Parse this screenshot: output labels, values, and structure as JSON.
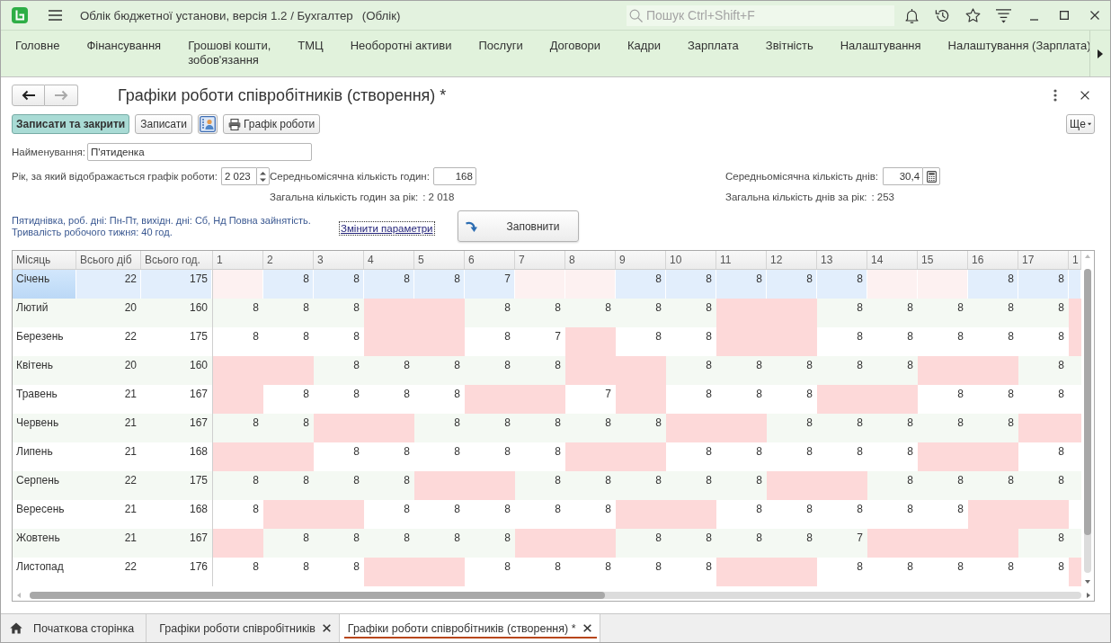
{
  "app": {
    "title": "Облік бюджетної установи, версія 1.2 / Бухгалтер",
    "mode": "(Облік)",
    "search": {
      "placeholder": "Пошук Ctrl+Shift+F"
    }
  },
  "menu": [
    "Головне",
    "Фінансування",
    "Грошові кошти,\nзобов'язання",
    "ТМЦ",
    "Необоротні активи",
    "Послуги",
    "Договори",
    "Кадри",
    "Зарплата",
    "Звітність",
    "Налаштування",
    "Налаштування (Зарплата)"
  ],
  "form": {
    "navigation": [
      {
        "kind": "back",
        "disabled": false
      },
      {
        "kind": "forward",
        "disabled": true
      }
    ],
    "title": "Графіки роботи співробітників (створення) *",
    "toolbar": [
      {
        "kind": "default",
        "label": "Записати та закрити"
      },
      {
        "kind": "plain",
        "label": "Записати"
      },
      {
        "kind": "contacts"
      },
      {
        "kind": "print",
        "label": "Графік роботи"
      }
    ],
    "more": "Ще",
    "name": {
      "label": "Найменування:",
      "value": "П'ятиденка"
    },
    "year": {
      "label": "Рік, за який відображається графік роботи:",
      "value": "2 023"
    },
    "avg_hours": {
      "label": "Середньомісячна кількість годин:",
      "value": "168"
    },
    "avg_days": {
      "label": "Середньомісячна кількість днів:",
      "value": "30,4"
    },
    "total_hours": {
      "label": "Загальна кількість годин за рік:",
      "value": ": 2 018"
    },
    "total_days": {
      "label": "Загальна кількість днів за рік:",
      "value": ": 253"
    },
    "description": [
      "Пятиднівка, роб. дні: Пн-Пт, вихідн. дні: Сб, Нд Повна зайнятість.",
      "Тривалість робочого тижня: 40 год."
    ],
    "change_link": {
      "label": "Змінити параметри",
      "focused": true
    },
    "fill_button": "Заповнити"
  },
  "table": {
    "columns": [
      "Місяць",
      "Всього діб",
      "Всього год.",
      "1",
      "2",
      "3",
      "4",
      "5",
      "6",
      "7",
      "8",
      "9",
      "10",
      "11",
      "12",
      "13",
      "14",
      "15",
      "16",
      "17",
      "1"
    ],
    "rows": [
      {
        "month": "Січень",
        "days": "22",
        "hours": "175",
        "selected": true,
        "cells": [
          {
            "holiday": true
          },
          {
            "value": "8",
            "holiday": false
          },
          {
            "value": "8",
            "holiday": false
          },
          {
            "value": "8",
            "holiday": false
          },
          {
            "value": "8",
            "holiday": false
          },
          {
            "value": "7",
            "holiday": false
          },
          {
            "holiday": true
          },
          {
            "holiday": true
          },
          {
            "value": "8",
            "holiday": false
          },
          {
            "value": "8",
            "holiday": false
          },
          {
            "value": "8",
            "holiday": false
          },
          {
            "value": "8",
            "holiday": false
          },
          {
            "value": "8",
            "holiday": false
          },
          {
            "holiday": true
          },
          {
            "holiday": true
          },
          {
            "value": "8",
            "holiday": false
          },
          {
            "value": "8",
            "holiday": false
          },
          {
            "holiday": false
          }
        ]
      },
      {
        "month": "Лютий",
        "days": "20",
        "hours": "160",
        "selected": false,
        "cells": [
          {
            "value": "8",
            "holiday": false
          },
          {
            "value": "8",
            "holiday": false
          },
          {
            "value": "8",
            "holiday": false
          },
          {
            "holiday": true
          },
          {
            "holiday": true
          },
          {
            "value": "8",
            "holiday": false
          },
          {
            "value": "8",
            "holiday": false
          },
          {
            "value": "8",
            "holiday": false
          },
          {
            "value": "8",
            "holiday": false
          },
          {
            "value": "8",
            "holiday": false
          },
          {
            "holiday": true
          },
          {
            "holiday": true
          },
          {
            "value": "8",
            "holiday": false
          },
          {
            "value": "8",
            "holiday": false
          },
          {
            "value": "8",
            "holiday": false
          },
          {
            "value": "8",
            "holiday": false
          },
          {
            "value": "8",
            "holiday": false
          },
          {
            "holiday": true
          }
        ]
      },
      {
        "month": "Березень",
        "days": "22",
        "hours": "175",
        "selected": false,
        "cells": [
          {
            "value": "8",
            "holiday": false
          },
          {
            "value": "8",
            "holiday": false
          },
          {
            "value": "8",
            "holiday": false
          },
          {
            "holiday": true
          },
          {
            "holiday": true
          },
          {
            "value": "8",
            "holiday": false
          },
          {
            "value": "7",
            "holiday": false
          },
          {
            "holiday": true
          },
          {
            "value": "8",
            "holiday": false
          },
          {
            "value": "8",
            "holiday": false
          },
          {
            "holiday": true
          },
          {
            "holiday": true
          },
          {
            "value": "8",
            "holiday": false
          },
          {
            "value": "8",
            "holiday": false
          },
          {
            "value": "8",
            "holiday": false
          },
          {
            "value": "8",
            "holiday": false
          },
          {
            "value": "8",
            "holiday": false
          },
          {
            "holiday": true
          }
        ]
      },
      {
        "month": "Квітень",
        "days": "20",
        "hours": "160",
        "selected": false,
        "cells": [
          {
            "holiday": true
          },
          {
            "holiday": true
          },
          {
            "value": "8",
            "holiday": false
          },
          {
            "value": "8",
            "holiday": false
          },
          {
            "value": "8",
            "holiday": false
          },
          {
            "value": "8",
            "holiday": false
          },
          {
            "value": "8",
            "holiday": false
          },
          {
            "holiday": true
          },
          {
            "holiday": true
          },
          {
            "value": "8",
            "holiday": false
          },
          {
            "value": "8",
            "holiday": false
          },
          {
            "value": "8",
            "holiday": false
          },
          {
            "value": "8",
            "holiday": false
          },
          {
            "value": "8",
            "holiday": false
          },
          {
            "holiday": true
          },
          {
            "holiday": true
          },
          {
            "value": "8",
            "holiday": false
          },
          {
            "holiday": false
          }
        ]
      },
      {
        "month": "Травень",
        "days": "21",
        "hours": "167",
        "selected": false,
        "cells": [
          {
            "holiday": true
          },
          {
            "value": "8",
            "holiday": false
          },
          {
            "value": "8",
            "holiday": false
          },
          {
            "value": "8",
            "holiday": false
          },
          {
            "value": "8",
            "holiday": false
          },
          {
            "holiday": true
          },
          {
            "holiday": true
          },
          {
            "value": "7",
            "holiday": false
          },
          {
            "holiday": true
          },
          {
            "value": "8",
            "holiday": false
          },
          {
            "value": "8",
            "holiday": false
          },
          {
            "value": "8",
            "holiday": false
          },
          {
            "holiday": true
          },
          {
            "holiday": true
          },
          {
            "value": "8",
            "holiday": false
          },
          {
            "value": "8",
            "holiday": false
          },
          {
            "value": "8",
            "holiday": false
          },
          {
            "holiday": false
          }
        ]
      },
      {
        "month": "Червень",
        "days": "21",
        "hours": "167",
        "selected": false,
        "cells": [
          {
            "value": "8",
            "holiday": false
          },
          {
            "value": "8",
            "holiday": false
          },
          {
            "holiday": true
          },
          {
            "holiday": true
          },
          {
            "value": "8",
            "holiday": false
          },
          {
            "value": "8",
            "holiday": false
          },
          {
            "value": "8",
            "holiday": false
          },
          {
            "value": "8",
            "holiday": false
          },
          {
            "value": "8",
            "holiday": false
          },
          {
            "holiday": true
          },
          {
            "holiday": true
          },
          {
            "value": "8",
            "holiday": false
          },
          {
            "value": "8",
            "holiday": false
          },
          {
            "value": "8",
            "holiday": false
          },
          {
            "value": "8",
            "holiday": false
          },
          {
            "value": "8",
            "holiday": false
          },
          {
            "holiday": true
          },
          {
            "holiday": true
          }
        ]
      },
      {
        "month": "Липень",
        "days": "21",
        "hours": "168",
        "selected": false,
        "cells": [
          {
            "holiday": true
          },
          {
            "holiday": true
          },
          {
            "value": "8",
            "holiday": false
          },
          {
            "value": "8",
            "holiday": false
          },
          {
            "value": "8",
            "holiday": false
          },
          {
            "value": "8",
            "holiday": false
          },
          {
            "value": "8",
            "holiday": false
          },
          {
            "holiday": true
          },
          {
            "holiday": true
          },
          {
            "value": "8",
            "holiday": false
          },
          {
            "value": "8",
            "holiday": false
          },
          {
            "value": "8",
            "holiday": false
          },
          {
            "value": "8",
            "holiday": false
          },
          {
            "value": "8",
            "holiday": false
          },
          {
            "holiday": true
          },
          {
            "holiday": true
          },
          {
            "value": "8",
            "holiday": false
          },
          {
            "holiday": false
          }
        ]
      },
      {
        "month": "Серпень",
        "days": "22",
        "hours": "175",
        "selected": false,
        "cells": [
          {
            "value": "8",
            "holiday": false
          },
          {
            "value": "8",
            "holiday": false
          },
          {
            "value": "8",
            "holiday": false
          },
          {
            "value": "8",
            "holiday": false
          },
          {
            "holiday": true
          },
          {
            "holiday": true
          },
          {
            "value": "8",
            "holiday": false
          },
          {
            "value": "8",
            "holiday": false
          },
          {
            "value": "8",
            "holiday": false
          },
          {
            "value": "8",
            "holiday": false
          },
          {
            "value": "8",
            "holiday": false
          },
          {
            "holiday": true
          },
          {
            "holiday": true
          },
          {
            "value": "8",
            "holiday": false
          },
          {
            "value": "8",
            "holiday": false
          },
          {
            "value": "8",
            "holiday": false
          },
          {
            "value": "8",
            "holiday": false
          },
          {
            "holiday": false
          }
        ]
      },
      {
        "month": "Вересень",
        "days": "21",
        "hours": "168",
        "selected": false,
        "cells": [
          {
            "value": "8",
            "holiday": false
          },
          {
            "holiday": true
          },
          {
            "holiday": true
          },
          {
            "value": "8",
            "holiday": false
          },
          {
            "value": "8",
            "holiday": false
          },
          {
            "value": "8",
            "holiday": false
          },
          {
            "value": "8",
            "holiday": false
          },
          {
            "value": "8",
            "holiday": false
          },
          {
            "holiday": true
          },
          {
            "holiday": true
          },
          {
            "value": "8",
            "holiday": false
          },
          {
            "value": "8",
            "holiday": false
          },
          {
            "value": "8",
            "holiday": false
          },
          {
            "value": "8",
            "holiday": false
          },
          {
            "value": "8",
            "holiday": false
          },
          {
            "holiday": true
          },
          {
            "holiday": true
          },
          {
            "holiday": false
          }
        ]
      },
      {
        "month": "Жовтень",
        "days": "21",
        "hours": "167",
        "selected": false,
        "cells": [
          {
            "holiday": true
          },
          {
            "value": "8",
            "holiday": false
          },
          {
            "value": "8",
            "holiday": false
          },
          {
            "value": "8",
            "holiday": false
          },
          {
            "value": "8",
            "holiday": false
          },
          {
            "value": "8",
            "holiday": false
          },
          {
            "holiday": true
          },
          {
            "holiday": true
          },
          {
            "value": "8",
            "holiday": false
          },
          {
            "value": "8",
            "holiday": false
          },
          {
            "value": "8",
            "holiday": false
          },
          {
            "value": "8",
            "holiday": false
          },
          {
            "value": "7",
            "holiday": false
          },
          {
            "holiday": true
          },
          {
            "holiday": true
          },
          {
            "holiday": true
          },
          {
            "value": "8",
            "holiday": false
          },
          {
            "holiday": false
          }
        ]
      },
      {
        "month": "Листопад",
        "days": "22",
        "hours": "176",
        "selected": false,
        "cells": [
          {
            "value": "8",
            "holiday": false
          },
          {
            "value": "8",
            "holiday": false
          },
          {
            "value": "8",
            "holiday": false
          },
          {
            "holiday": true
          },
          {
            "holiday": true
          },
          {
            "value": "8",
            "holiday": false
          },
          {
            "value": "8",
            "holiday": false
          },
          {
            "value": "8",
            "holiday": false
          },
          {
            "value": "8",
            "holiday": false
          },
          {
            "value": "8",
            "holiday": false
          },
          {
            "holiday": true
          },
          {
            "holiday": true
          },
          {
            "value": "8",
            "holiday": false
          },
          {
            "value": "8",
            "holiday": false
          },
          {
            "value": "8",
            "holiday": false
          },
          {
            "value": "8",
            "holiday": false
          },
          {
            "value": "8",
            "holiday": false
          },
          {
            "holiday": true
          }
        ]
      }
    ]
  },
  "tabs": [
    {
      "kind": "home",
      "label": "Початкова сторінка",
      "selected": false
    },
    {
      "kind": "document",
      "label": "Графіки роботи співробітників",
      "selected": false
    },
    {
      "kind": "document",
      "label": "Графіки роботи співробітників (створення) *",
      "selected": true
    }
  ]
}
